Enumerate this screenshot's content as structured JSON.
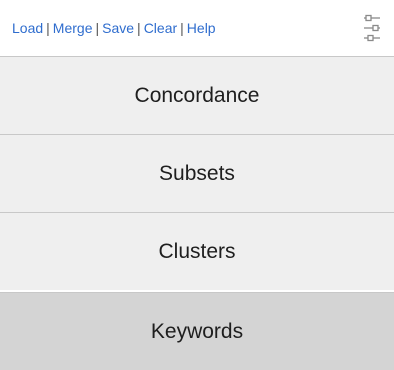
{
  "toolbar": {
    "links": [
      {
        "label": "Load"
      },
      {
        "label": "Merge"
      },
      {
        "label": "Save"
      },
      {
        "label": "Clear"
      },
      {
        "label": "Help"
      }
    ],
    "separator": "|",
    "settings_icon": "sliders-icon"
  },
  "menu": {
    "items": [
      {
        "label": "Concordance",
        "active": false
      },
      {
        "label": "Subsets",
        "active": false
      },
      {
        "label": "Clusters",
        "active": false
      },
      {
        "label": "Keywords",
        "active": true
      }
    ]
  },
  "colors": {
    "link": "#2f6dce",
    "item_bg": "#efefef",
    "item_active_bg": "#d4d4d4",
    "divider": "#c8c8c8",
    "icon": "#8a8a8a"
  }
}
